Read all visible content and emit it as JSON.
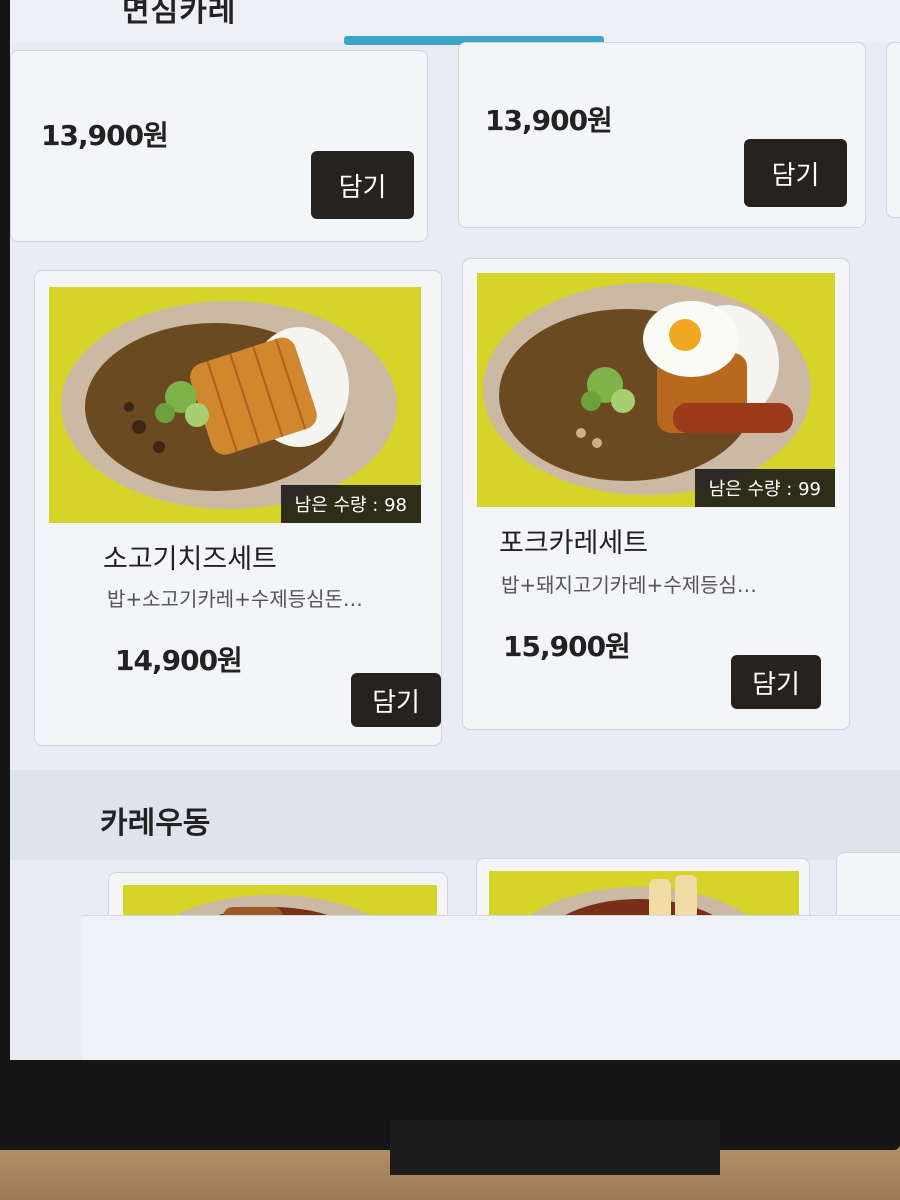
{
  "header": {
    "category_label": "면심카레"
  },
  "top_row": [
    {
      "price": "13,900원",
      "button_label": "담기"
    },
    {
      "price": "13,900원",
      "button_label": "담기"
    }
  ],
  "items": [
    {
      "name": "소고기치즈세트",
      "description": "밥+소고기카레+수제등심돈…",
      "price": "14,900원",
      "stock_label": "남은 수량 : 98",
      "button_label": "담기"
    },
    {
      "name": "포크카레세트",
      "description": "밥+돼지고기카레+수제등심…",
      "price": "15,900원",
      "stock_label": "남은 수량 : 99",
      "button_label": "담기"
    }
  ],
  "section": {
    "title": "카레우동"
  },
  "colors": {
    "tab_indicator": "#3aa5c4",
    "button_bg": "#262220",
    "image_bg": "#d4d42a",
    "curry": "#6b4a22"
  }
}
